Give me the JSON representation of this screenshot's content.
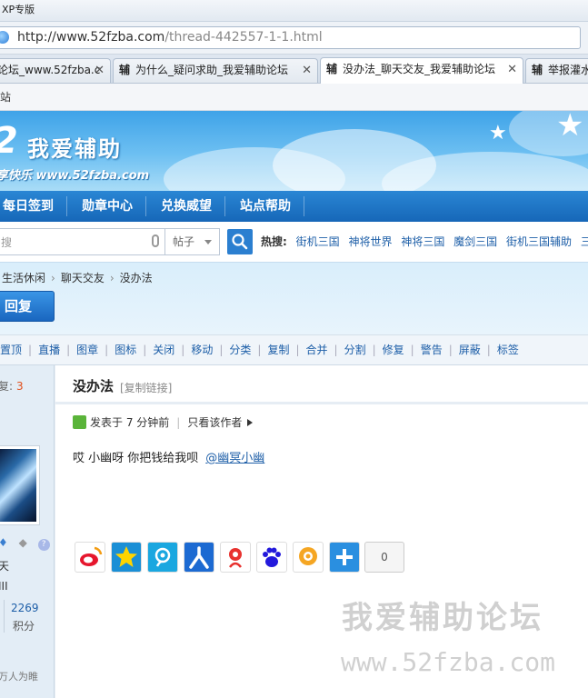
{
  "window": {
    "title": "XP专版"
  },
  "address_bar": {
    "host": "http://www.52fzba.com",
    "path": "/thread-442557-1-1.html"
  },
  "tabs": [
    {
      "label": "论坛_www.52fzba.c",
      "favicon": ""
    },
    {
      "label": "为什么_疑问求助_我爱辅助论坛",
      "favicon": "辅"
    },
    {
      "label": "没办法_聊天交友_我爱辅助论坛",
      "favicon": "辅"
    },
    {
      "label": "举报灌水",
      "favicon": "辅"
    }
  ],
  "bookmarks": {
    "item": "站"
  },
  "header": {
    "logo_number": "2",
    "logo_title": "我爱辅助",
    "logo_subtitle": "享快乐 www.52fzba.com"
  },
  "nav": {
    "items": [
      "每日签到",
      "勋章中心",
      "兑换威望",
      "站点帮助"
    ]
  },
  "search": {
    "placeholder": "搜",
    "type": "帖子",
    "hot_label": "热搜:",
    "hot_links": [
      "街机三国",
      "神将世界",
      "神将三国",
      "魔剑三国",
      "街机三国辅助",
      "三国"
    ]
  },
  "breadcrumb": {
    "items": [
      "生活休闲",
      "聊天交友",
      "没办法"
    ]
  },
  "reply_button": "回复",
  "toolbar": {
    "items": [
      "置顶",
      "直播",
      "图章",
      "图标",
      "关闭",
      "移动",
      "分类",
      "复制",
      "合并",
      "分割",
      "修复",
      "警告",
      "屏蔽",
      "标签"
    ]
  },
  "sidebar": {
    "reply_label": "复:",
    "reply_count": "3",
    "user_line1": "天",
    "user_line2": "III",
    "points_value": "2269",
    "points_label": "积分",
    "signature": "万人为睢"
  },
  "post": {
    "title": "没办法",
    "copy_link": "[复制链接]",
    "posted": "发表于 7 分钟前",
    "only_author": "只看该作者",
    "body": "哎  小幽呀 你把钱给我呗",
    "mention": "@幽冥小幽",
    "share_count": "0"
  },
  "watermark": {
    "title": "我爱辅助论坛",
    "url": "www.52fzba.com"
  },
  "colors": {
    "nav_blue": "#1a6dbd",
    "link_blue": "#1e5fa8",
    "reply_count_orange": "#e24f1b"
  }
}
